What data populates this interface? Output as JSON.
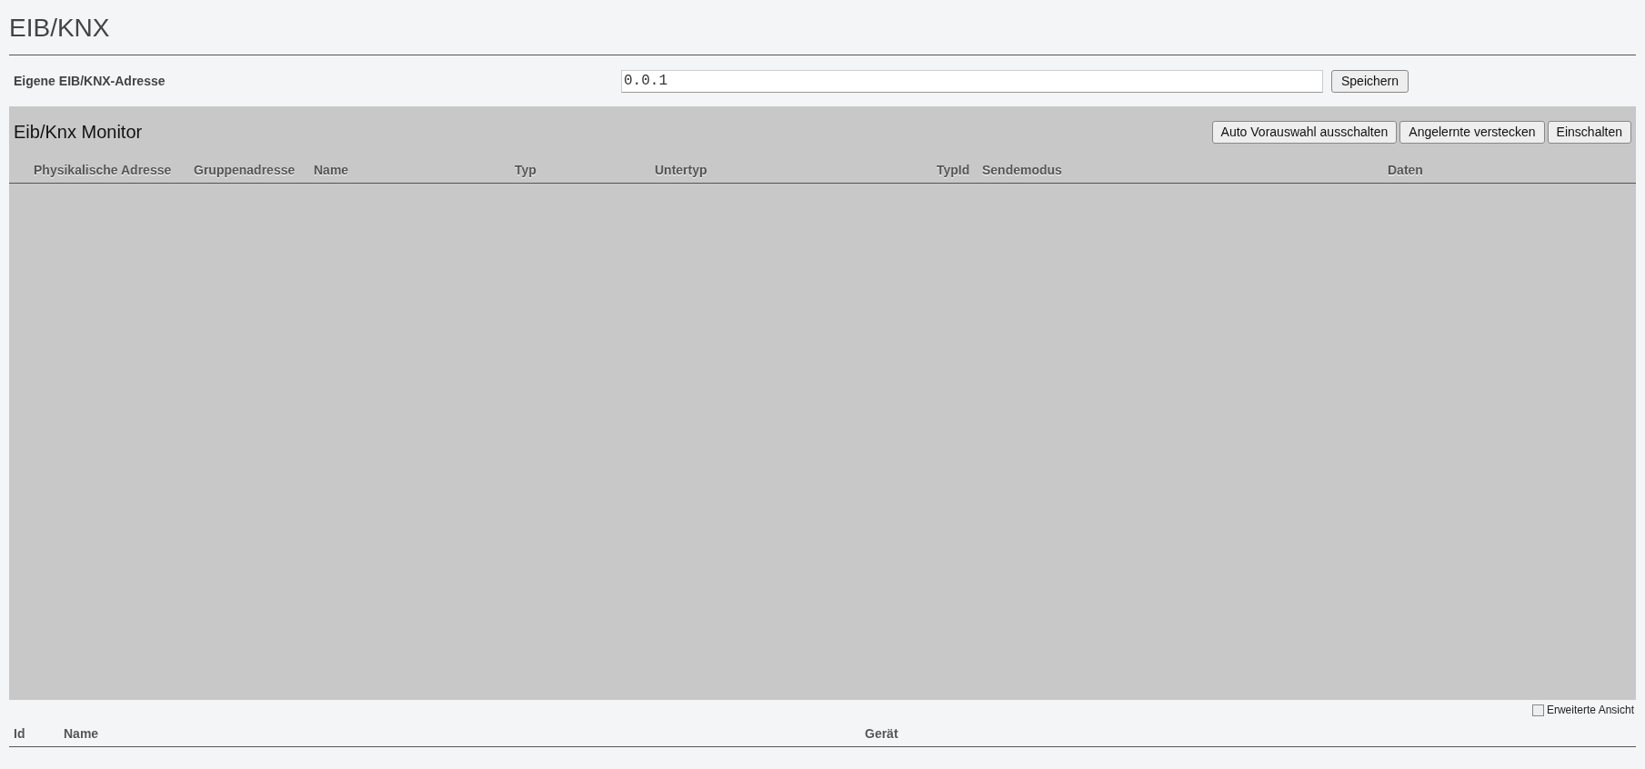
{
  "page_title": "EIB/KNX",
  "own_address": {
    "label": "Eigene EIB/KNX-Adresse",
    "value": "0.0.1",
    "save_button": "Speichern"
  },
  "monitor": {
    "title": "Eib/Knx Monitor",
    "buttons": [
      "Auto Vorauswahl ausschalten",
      "Angelernte verstecken",
      "Einschalten"
    ],
    "columns": [
      "Physikalische Adresse",
      "Gruppenadresse",
      "Name",
      "Typ",
      "Untertyp",
      "TypId",
      "Sendemodus",
      "Daten"
    ]
  },
  "extended_view": {
    "label": "Erweiterte Ansicht",
    "checked": false
  },
  "devices_table": {
    "columns": [
      "Id",
      "Name",
      "Gerät"
    ]
  }
}
